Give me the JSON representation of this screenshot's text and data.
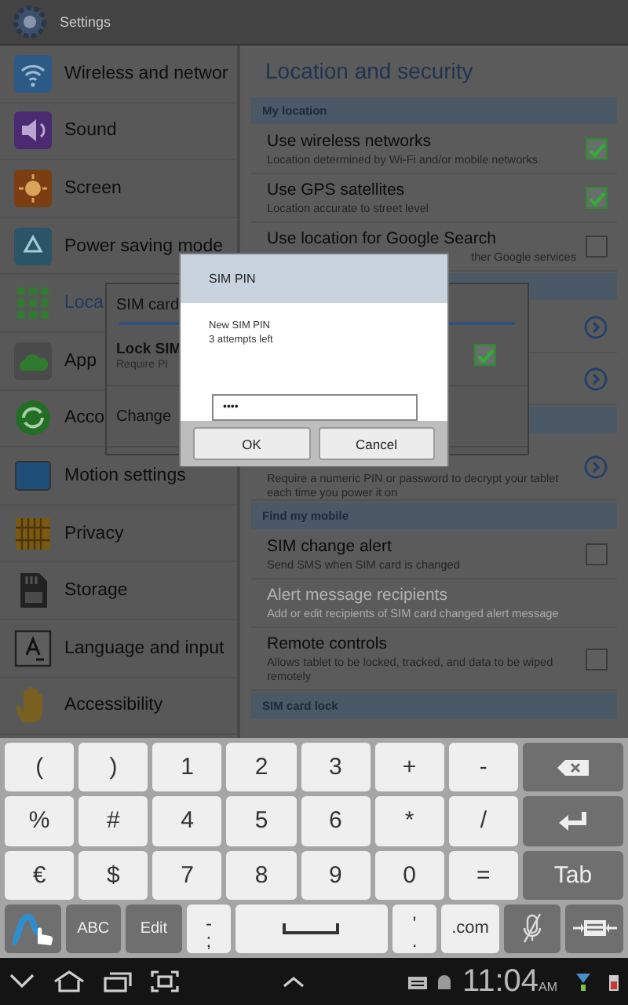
{
  "header": {
    "title": "Settings"
  },
  "sidebar": {
    "items": [
      {
        "label": "Wireless and networ",
        "selected": false
      },
      {
        "label": "Sound",
        "selected": false
      },
      {
        "label": "Screen",
        "selected": false
      },
      {
        "label": "Power saving mode",
        "selected": false
      },
      {
        "label": "Loca",
        "selected": true
      },
      {
        "label": "App",
        "selected": false
      },
      {
        "label": "Acco",
        "selected": false
      },
      {
        "label": "Motion settings",
        "selected": false
      },
      {
        "label": "Privacy",
        "selected": false
      },
      {
        "label": "Storage",
        "selected": false
      },
      {
        "label": "Language and input",
        "selected": false
      },
      {
        "label": "Accessibility",
        "selected": false
      }
    ]
  },
  "panel": {
    "title": "Location and security",
    "rows": [
      {
        "kind": "section",
        "label": "My location"
      },
      {
        "kind": "check",
        "title": "Use wireless networks",
        "subtitle": "Location determined by Wi-Fi and/or mobile networks",
        "checked": true
      },
      {
        "kind": "check",
        "title": "Use GPS satellites",
        "subtitle": "Location accurate to street level",
        "checked": true
      },
      {
        "kind": "covered-check",
        "title": "Use location for Google Search",
        "subtitle": "ther Google services",
        "checked": false
      },
      {
        "kind": "section"
      },
      {
        "kind": "link"
      },
      {
        "kind": "link"
      },
      {
        "kind": "section"
      },
      {
        "kind": "link",
        "subtitle": "Require a numeric PIN or password to decrypt your tablet each time you power it on"
      },
      {
        "kind": "section",
        "label": "Find my mobile"
      },
      {
        "kind": "check",
        "title": "SIM change alert",
        "subtitle": "Send SMS when SIM card is changed",
        "checked": false
      },
      {
        "kind": "plain",
        "title": "Alert message recipients",
        "subtitle": "Add or edit recipients of SIM card changed alert message",
        "disabled": true
      },
      {
        "kind": "check",
        "title": "Remote controls",
        "subtitle": "Allows tablet to be locked, tracked, and data to be wiped remotely",
        "checked": false
      },
      {
        "kind": "section",
        "label": "SIM card lock"
      }
    ]
  },
  "lock_dialog": {
    "title": "SIM card",
    "items": [
      {
        "title": "Lock SIM",
        "subtitle": "Require PI",
        "checked": true
      },
      {
        "title": "Change"
      }
    ]
  },
  "pin_dialog": {
    "title": "SIM PIN",
    "lines": [
      "New SIM PIN",
      "3 attempts left"
    ],
    "value": "••••",
    "buttons": [
      "OK",
      "Cancel"
    ]
  },
  "keyboard": {
    "rows": [
      [
        {
          "kind": "char",
          "label": "("
        },
        {
          "kind": "char",
          "label": ")"
        },
        {
          "kind": "char",
          "label": "1"
        },
        {
          "kind": "char",
          "label": "2"
        },
        {
          "kind": "char",
          "label": "3"
        },
        {
          "kind": "char",
          "label": "+"
        },
        {
          "kind": "char",
          "label": "-"
        },
        {
          "kind": "backspace"
        }
      ],
      [
        {
          "kind": "char",
          "label": "%"
        },
        {
          "kind": "char",
          "label": "#"
        },
        {
          "kind": "char",
          "label": "4"
        },
        {
          "kind": "char",
          "label": "5"
        },
        {
          "kind": "char",
          "label": "6"
        },
        {
          "kind": "char",
          "label": "*"
        },
        {
          "kind": "char",
          "label": "/"
        },
        {
          "kind": "enter"
        }
      ],
      [
        {
          "kind": "char",
          "label": "€"
        },
        {
          "kind": "char",
          "label": "$"
        },
        {
          "kind": "char",
          "label": "7"
        },
        {
          "kind": "char",
          "label": "8"
        },
        {
          "kind": "char",
          "label": "9"
        },
        {
          "kind": "char",
          "label": "0"
        },
        {
          "kind": "char",
          "label": "="
        },
        {
          "kind": "dark",
          "label": "Tab"
        }
      ],
      [
        {
          "kind": "swype"
        },
        {
          "kind": "dark",
          "label": "ABC"
        },
        {
          "kind": "dark",
          "label": "Edit"
        },
        {
          "kind": "dual",
          "top": "-",
          "label": ";"
        },
        {
          "kind": "space"
        },
        {
          "kind": "dual",
          "top": "'",
          "label": "."
        },
        {
          "kind": "char",
          "label": ".com"
        },
        {
          "kind": "mic"
        },
        {
          "kind": "keyboard"
        }
      ]
    ]
  },
  "status_bar": {
    "time": "11:04",
    "ampm": "AM"
  }
}
